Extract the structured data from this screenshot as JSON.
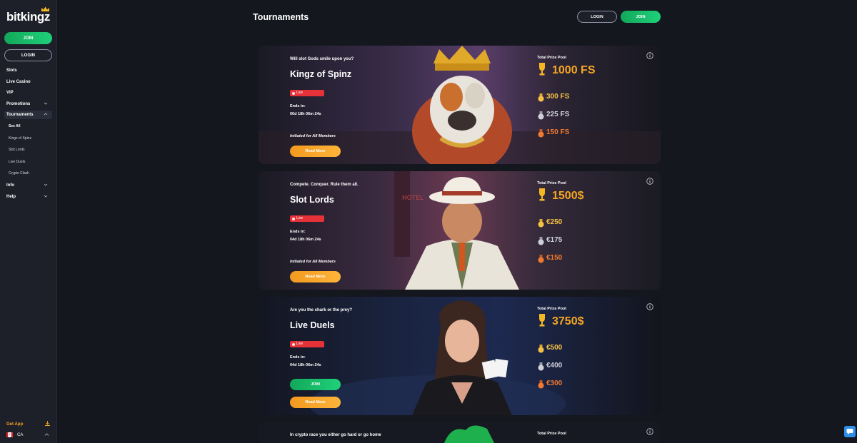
{
  "brand": {
    "logo_text": "bitkingz"
  },
  "sidebar": {
    "join_label": "JOIN",
    "login_label": "LOGIN",
    "items": [
      {
        "label": "Slots"
      },
      {
        "label": "Live Casino"
      },
      {
        "label": "VIP"
      },
      {
        "label": "Promotions"
      },
      {
        "label": "Tournaments"
      }
    ],
    "tournament_sub": [
      "See All",
      "Kingz of Spinz",
      "Slot Lords",
      "Live Duels",
      "Crypto Clash"
    ],
    "info_label": "Info",
    "help_label": "Help",
    "get_app_label": "Get App",
    "region_label": "CA"
  },
  "header": {
    "title": "Tournaments",
    "login_label": "LOGIN",
    "join_label": "JOIN"
  },
  "cards": [
    {
      "kicker": "Will slot Gods smile upon you?",
      "title": "Kingz of Spinz",
      "status": "Live",
      "ends_label": "Ends in:",
      "ends_value": "00d 18h 06m 24s",
      "initiated": "Initiated for All Members",
      "read_more": "Read More",
      "pool_label": "Total Prize Pool",
      "pool_value": "1000 FS",
      "prizes": [
        "300 FS",
        "225 FS",
        "150 FS"
      ]
    },
    {
      "kicker": "Compete. Conquer. Rule them all.",
      "title": "Slot Lords",
      "status": "Live",
      "ends_label": "Ends in:",
      "ends_value": "04d 18h 06m 24s",
      "initiated": "Initiated for All Members",
      "read_more": "Read More",
      "pool_label": "Total Prize Pool",
      "pool_value": "1500$",
      "prizes": [
        "€250",
        "€175",
        "€150"
      ],
      "art_text": "HOTEL"
    },
    {
      "kicker": "Are you the shark or the prey?",
      "title": "Live Duels",
      "status": "Live",
      "ends_label": "Ends in:",
      "ends_value": "04d 18h 06m 24s",
      "join_label": "JOIN",
      "read_more": "Read More",
      "pool_label": "Total Prize Pool",
      "pool_value": "3750$",
      "prizes": [
        "€500",
        "€400",
        "€300"
      ]
    },
    {
      "kicker": "In crypto race you either go hard or go home",
      "pool_label": "Total Prize Pool"
    }
  ],
  "colors": {
    "background": "#15171f",
    "sidebar": "#1d1f29",
    "join_green": "#1fd07a",
    "accent_orange": "#f5a623",
    "live_red": "#e53238"
  }
}
